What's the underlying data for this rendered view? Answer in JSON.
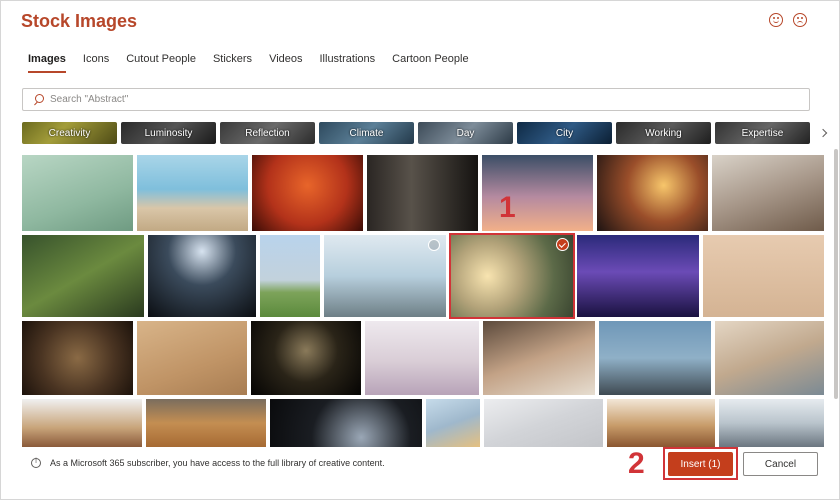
{
  "dialog": {
    "title": "Stock Images",
    "header_icons": [
      "smile-icon",
      "frown-icon"
    ]
  },
  "tabs": [
    {
      "label": "Images",
      "active": true
    },
    {
      "label": "Icons",
      "active": false
    },
    {
      "label": "Cutout People",
      "active": false
    },
    {
      "label": "Stickers",
      "active": false
    },
    {
      "label": "Videos",
      "active": false
    },
    {
      "label": "Illustrations",
      "active": false
    },
    {
      "label": "Cartoon People",
      "active": false
    }
  ],
  "search": {
    "placeholder": "Search \"Abstract\"",
    "value": ""
  },
  "categories": [
    {
      "label": "Creativity"
    },
    {
      "label": "Luminosity"
    },
    {
      "label": "Reflection"
    },
    {
      "label": "Climate"
    },
    {
      "label": "Day"
    },
    {
      "label": "City"
    },
    {
      "label": "Working"
    },
    {
      "label": "Expertise"
    }
  ],
  "images": {
    "total_visible": 30,
    "selected_index": 11,
    "selected_label": "olive-branch-sunset"
  },
  "annotations": {
    "step1": "1",
    "step2": "2"
  },
  "footer": {
    "info_text": "As a Microsoft 365 subscriber, you have access to the full library of creative content.",
    "insert_label": "Insert (1)",
    "cancel_label": "Cancel"
  },
  "colors": {
    "accent": "#b7472a",
    "insert_button": "#c43e1c",
    "highlight": "#d13438"
  }
}
